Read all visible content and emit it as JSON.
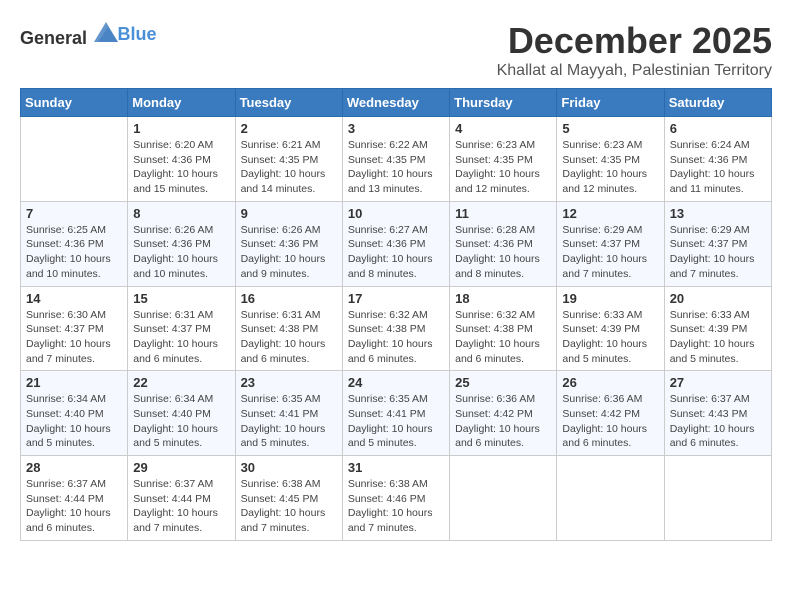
{
  "logo": {
    "general": "General",
    "blue": "Blue"
  },
  "title": {
    "month": "December 2025",
    "location": "Khallat al Mayyah, Palestinian Territory"
  },
  "weekdays": [
    "Sunday",
    "Monday",
    "Tuesday",
    "Wednesday",
    "Thursday",
    "Friday",
    "Saturday"
  ],
  "weeks": [
    [
      {
        "day": null
      },
      {
        "day": "1",
        "sunrise": "6:20 AM",
        "sunset": "4:36 PM",
        "daylight": "10 hours and 15 minutes."
      },
      {
        "day": "2",
        "sunrise": "6:21 AM",
        "sunset": "4:35 PM",
        "daylight": "10 hours and 14 minutes."
      },
      {
        "day": "3",
        "sunrise": "6:22 AM",
        "sunset": "4:35 PM",
        "daylight": "10 hours and 13 minutes."
      },
      {
        "day": "4",
        "sunrise": "6:23 AM",
        "sunset": "4:35 PM",
        "daylight": "10 hours and 12 minutes."
      },
      {
        "day": "5",
        "sunrise": "6:23 AM",
        "sunset": "4:35 PM",
        "daylight": "10 hours and 12 minutes."
      },
      {
        "day": "6",
        "sunrise": "6:24 AM",
        "sunset": "4:36 PM",
        "daylight": "10 hours and 11 minutes."
      }
    ],
    [
      {
        "day": "7",
        "sunrise": "6:25 AM",
        "sunset": "4:36 PM",
        "daylight": "10 hours and 10 minutes."
      },
      {
        "day": "8",
        "sunrise": "6:26 AM",
        "sunset": "4:36 PM",
        "daylight": "10 hours and 10 minutes."
      },
      {
        "day": "9",
        "sunrise": "6:26 AM",
        "sunset": "4:36 PM",
        "daylight": "10 hours and 9 minutes."
      },
      {
        "day": "10",
        "sunrise": "6:27 AM",
        "sunset": "4:36 PM",
        "daylight": "10 hours and 8 minutes."
      },
      {
        "day": "11",
        "sunrise": "6:28 AM",
        "sunset": "4:36 PM",
        "daylight": "10 hours and 8 minutes."
      },
      {
        "day": "12",
        "sunrise": "6:29 AM",
        "sunset": "4:37 PM",
        "daylight": "10 hours and 7 minutes."
      },
      {
        "day": "13",
        "sunrise": "6:29 AM",
        "sunset": "4:37 PM",
        "daylight": "10 hours and 7 minutes."
      }
    ],
    [
      {
        "day": "14",
        "sunrise": "6:30 AM",
        "sunset": "4:37 PM",
        "daylight": "10 hours and 7 minutes."
      },
      {
        "day": "15",
        "sunrise": "6:31 AM",
        "sunset": "4:37 PM",
        "daylight": "10 hours and 6 minutes."
      },
      {
        "day": "16",
        "sunrise": "6:31 AM",
        "sunset": "4:38 PM",
        "daylight": "10 hours and 6 minutes."
      },
      {
        "day": "17",
        "sunrise": "6:32 AM",
        "sunset": "4:38 PM",
        "daylight": "10 hours and 6 minutes."
      },
      {
        "day": "18",
        "sunrise": "6:32 AM",
        "sunset": "4:38 PM",
        "daylight": "10 hours and 6 minutes."
      },
      {
        "day": "19",
        "sunrise": "6:33 AM",
        "sunset": "4:39 PM",
        "daylight": "10 hours and 5 minutes."
      },
      {
        "day": "20",
        "sunrise": "6:33 AM",
        "sunset": "4:39 PM",
        "daylight": "10 hours and 5 minutes."
      }
    ],
    [
      {
        "day": "21",
        "sunrise": "6:34 AM",
        "sunset": "4:40 PM",
        "daylight": "10 hours and 5 minutes."
      },
      {
        "day": "22",
        "sunrise": "6:34 AM",
        "sunset": "4:40 PM",
        "daylight": "10 hours and 5 minutes."
      },
      {
        "day": "23",
        "sunrise": "6:35 AM",
        "sunset": "4:41 PM",
        "daylight": "10 hours and 5 minutes."
      },
      {
        "day": "24",
        "sunrise": "6:35 AM",
        "sunset": "4:41 PM",
        "daylight": "10 hours and 5 minutes."
      },
      {
        "day": "25",
        "sunrise": "6:36 AM",
        "sunset": "4:42 PM",
        "daylight": "10 hours and 6 minutes."
      },
      {
        "day": "26",
        "sunrise": "6:36 AM",
        "sunset": "4:42 PM",
        "daylight": "10 hours and 6 minutes."
      },
      {
        "day": "27",
        "sunrise": "6:37 AM",
        "sunset": "4:43 PM",
        "daylight": "10 hours and 6 minutes."
      }
    ],
    [
      {
        "day": "28",
        "sunrise": "6:37 AM",
        "sunset": "4:44 PM",
        "daylight": "10 hours and 6 minutes."
      },
      {
        "day": "29",
        "sunrise": "6:37 AM",
        "sunset": "4:44 PM",
        "daylight": "10 hours and 7 minutes."
      },
      {
        "day": "30",
        "sunrise": "6:38 AM",
        "sunset": "4:45 PM",
        "daylight": "10 hours and 7 minutes."
      },
      {
        "day": "31",
        "sunrise": "6:38 AM",
        "sunset": "4:46 PM",
        "daylight": "10 hours and 7 minutes."
      },
      {
        "day": null
      },
      {
        "day": null
      },
      {
        "day": null
      }
    ]
  ]
}
